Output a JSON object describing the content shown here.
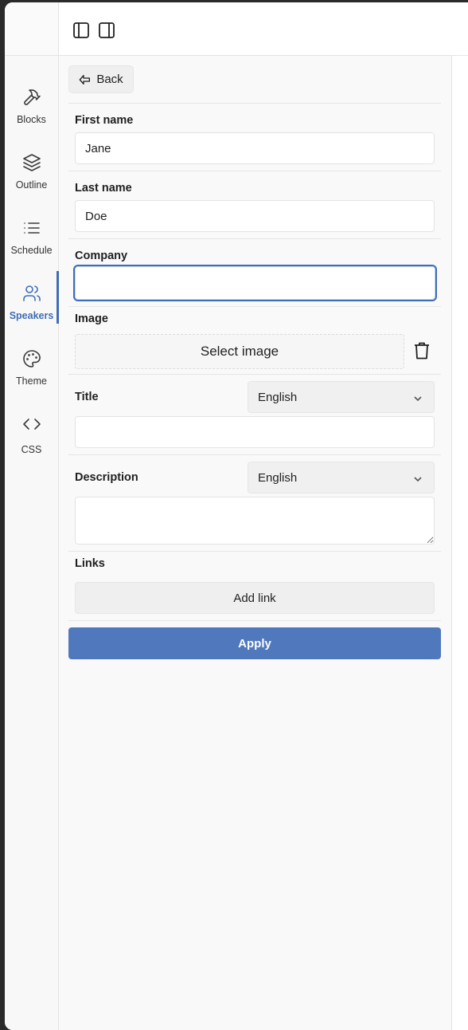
{
  "sidebar": {
    "items": [
      {
        "label": "Blocks",
        "icon": "hammer-icon",
        "active": false
      },
      {
        "label": "Outline",
        "icon": "layers-icon",
        "active": false
      },
      {
        "label": "Schedule",
        "icon": "list-icon",
        "active": false
      },
      {
        "label": "Speakers",
        "icon": "users-icon",
        "active": true
      },
      {
        "label": "Theme",
        "icon": "palette-icon",
        "active": false
      },
      {
        "label": "CSS",
        "icon": "code-icon",
        "active": false
      }
    ]
  },
  "toolbar": {
    "left_panel_icon": "panel-left-icon",
    "right_panel_icon": "panel-right-icon"
  },
  "form": {
    "back_label": "Back",
    "first_name": {
      "label": "First name",
      "value": "Jane"
    },
    "last_name": {
      "label": "Last name",
      "value": "Doe"
    },
    "company": {
      "label": "Company",
      "value": ""
    },
    "image": {
      "label": "Image",
      "button": "Select image"
    },
    "title": {
      "label": "Title",
      "language": "English",
      "value": ""
    },
    "description": {
      "label": "Description",
      "language": "English",
      "value": ""
    },
    "links": {
      "label": "Links",
      "button": "Add link"
    },
    "apply_label": "Apply"
  },
  "colors": {
    "accent": "#3f6db7",
    "apply_button": "#5078bd"
  }
}
